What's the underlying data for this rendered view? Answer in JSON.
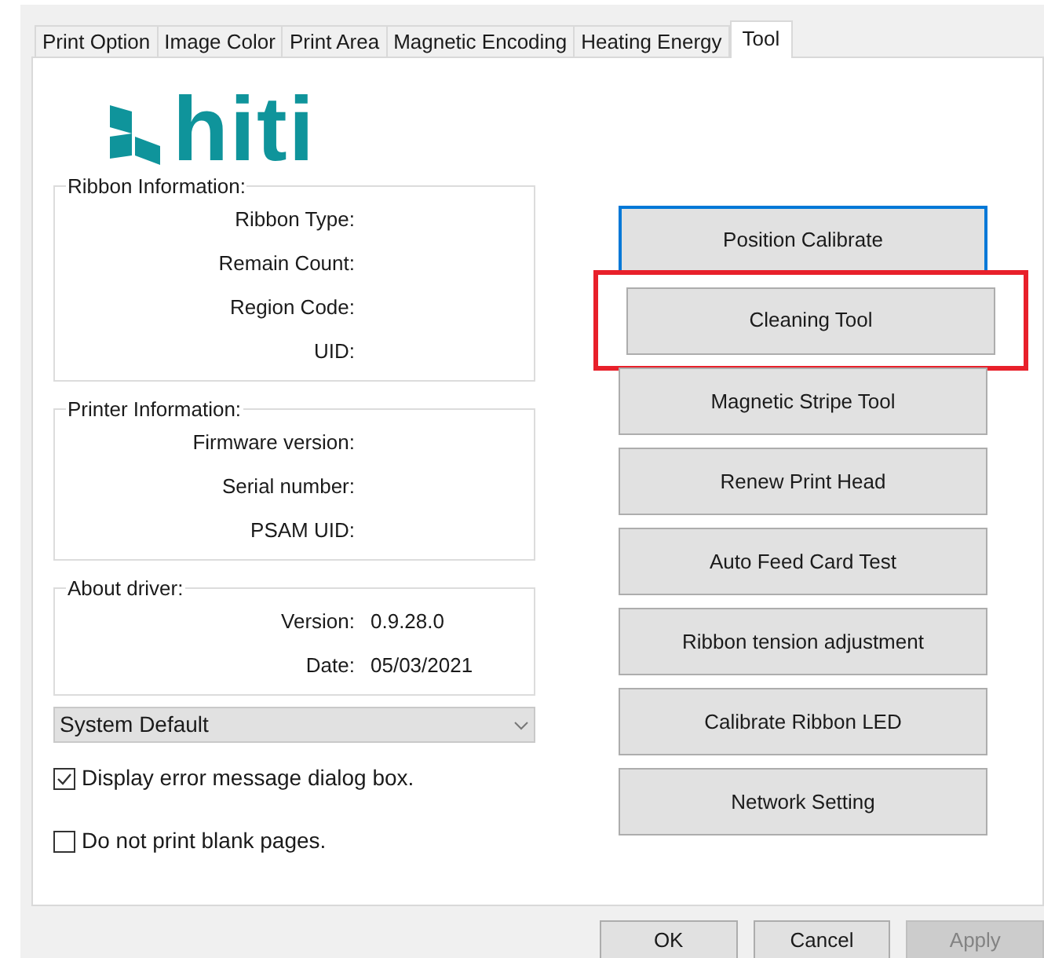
{
  "tabs": [
    {
      "label": "Print Option",
      "selected": false
    },
    {
      "label": "Image Color",
      "selected": false
    },
    {
      "label": "Print Area",
      "selected": false
    },
    {
      "label": "Magnetic Encoding",
      "selected": false
    },
    {
      "label": "Heating Energy",
      "selected": false
    },
    {
      "label": "Tool",
      "selected": true
    }
  ],
  "logo": {
    "text": "hiti"
  },
  "groups": [
    {
      "title": "Ribbon Information:",
      "rows": [
        {
          "label": "Ribbon Type:"
        },
        {
          "label": "Remain Count:"
        },
        {
          "label": "Region Code:"
        },
        {
          "label": "UID:"
        }
      ]
    },
    {
      "title": "Printer Information:",
      "rows": [
        {
          "label": "Firmware version:"
        },
        {
          "label": "Serial number:"
        },
        {
          "label": "PSAM UID:"
        }
      ]
    },
    {
      "title": "About driver:",
      "rows": [
        {
          "label": "Version:",
          "value": "0.9.28.0"
        },
        {
          "label": "Date:",
          "value": "05/03/2021"
        }
      ]
    }
  ],
  "language_dropdown": {
    "value": "System Default"
  },
  "checkboxes": [
    {
      "label": "Display error message dialog box.",
      "checked": true
    },
    {
      "label": "Do not print blank pages.",
      "checked": false
    }
  ],
  "tool_buttons": [
    {
      "label": "Position Calibrate",
      "focused": true,
      "highlighted": false
    },
    {
      "label": "Cleaning Tool",
      "focused": false,
      "highlighted": true
    },
    {
      "label": "Magnetic Stripe Tool",
      "focused": false,
      "highlighted": false
    },
    {
      "label": "Renew Print Head",
      "focused": false,
      "highlighted": false
    },
    {
      "label": "Auto Feed Card Test",
      "focused": false,
      "highlighted": false
    },
    {
      "label": "Ribbon tension adjustment",
      "focused": false,
      "highlighted": false
    },
    {
      "label": "Calibrate Ribbon LED",
      "focused": false,
      "highlighted": false
    },
    {
      "label": "Network Setting",
      "focused": false,
      "highlighted": false
    }
  ],
  "dialog_buttons": [
    {
      "label": "OK",
      "disabled": false
    },
    {
      "label": "Cancel",
      "disabled": false
    },
    {
      "label": "Apply",
      "disabled": true
    }
  ]
}
